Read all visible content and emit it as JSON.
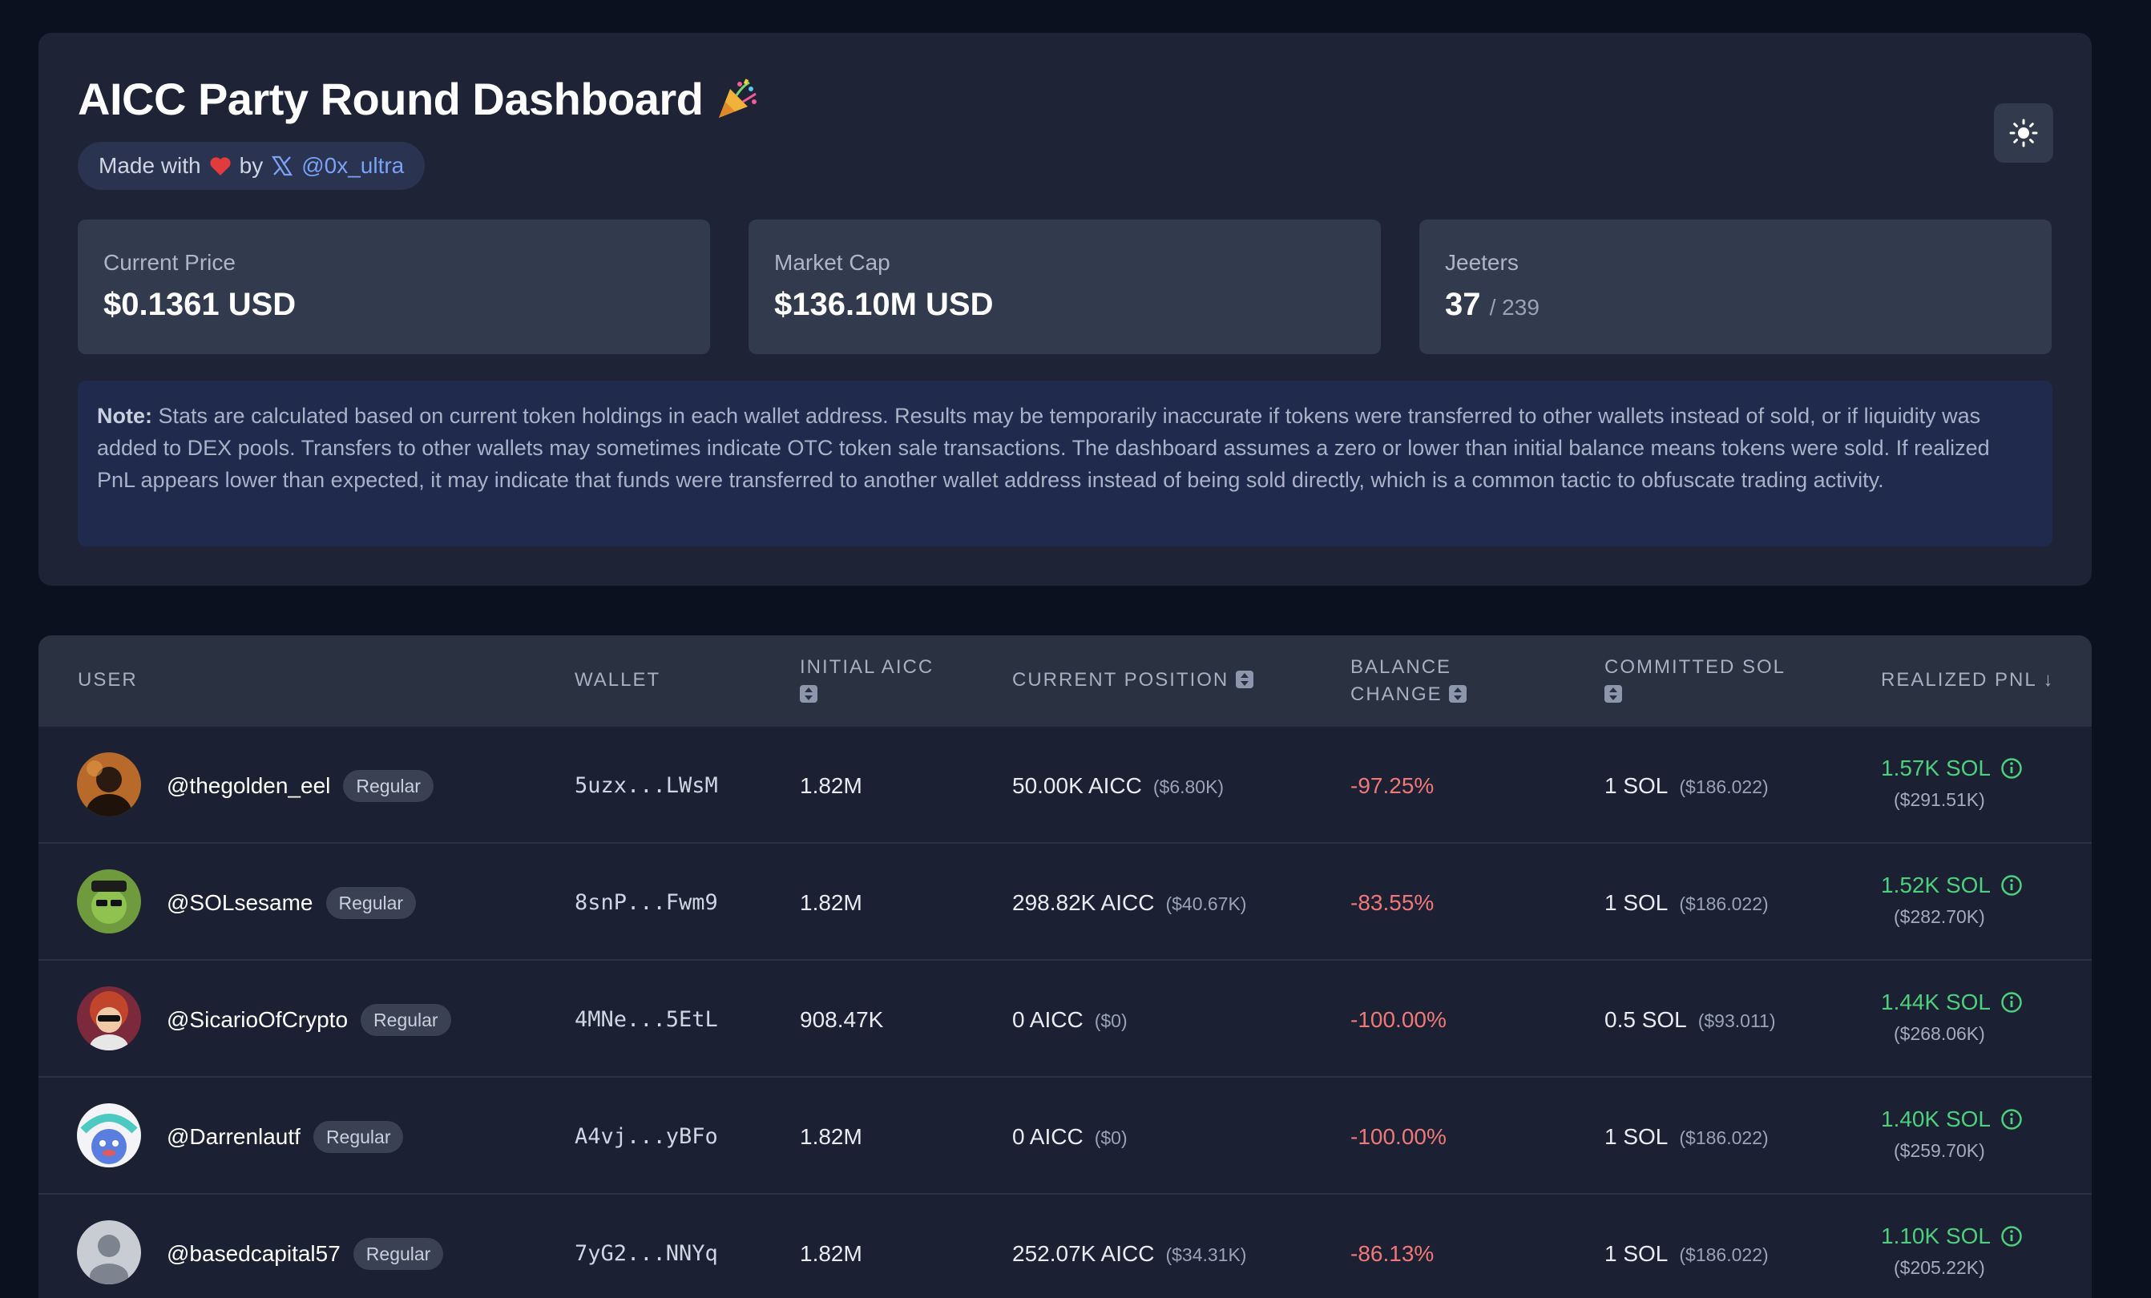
{
  "header": {
    "title": "AICC Party Round Dashboard",
    "credit": {
      "made_with": "Made with",
      "by": "by",
      "handle": "@0x_ultra"
    }
  },
  "stats": [
    {
      "label": "Current Price",
      "value": "$0.1361 USD",
      "sub": ""
    },
    {
      "label": "Market Cap",
      "value": "$136.10M USD",
      "sub": ""
    },
    {
      "label": "Jeeters",
      "value": "37",
      "sub": "/ 239"
    }
  ],
  "note": {
    "label": "Note:",
    "text": "Stats are calculated based on current token holdings in each wallet address. Results may be temporarily inaccurate if tokens were transferred to other wallets instead of sold, or if liquidity was added to DEX pools. Transfers to other wallets may sometimes indicate OTC token sale transactions. The dashboard assumes a zero or lower than initial balance means tokens were sold. If realized PnL appears lower than expected, it may indicate that funds were transferred to another wallet address instead of being sold directly, which is a common tactic to obfuscate trading activity."
  },
  "table": {
    "columns": {
      "user": "USER",
      "wallet": "WALLET",
      "initial_line1": "INITIAL AICC",
      "current_position": "CURRENT POSITION",
      "balance_line1": "BALANCE",
      "balance_line2": "CHANGE",
      "committed_line1": "COMMITTED SOL",
      "realized_pnl": "REALIZED PNL ↓"
    },
    "rows": [
      {
        "user": "@thegolden_eel",
        "badge": "Regular",
        "wallet": "5uzx...LWsM",
        "initial": "1.82M",
        "position": "50.00K AICC",
        "position_usd": "($6.80K)",
        "balance_change": "-97.25%",
        "committed": "1 SOL",
        "committed_usd": "($186.022)",
        "pnl": "1.57K SOL",
        "pnl_usd": "($291.51K)"
      },
      {
        "user": "@SOLsesame",
        "badge": "Regular",
        "wallet": "8snP...Fwm9",
        "initial": "1.82M",
        "position": "298.82K AICC",
        "position_usd": "($40.67K)",
        "balance_change": "-83.55%",
        "committed": "1 SOL",
        "committed_usd": "($186.022)",
        "pnl": "1.52K SOL",
        "pnl_usd": "($282.70K)"
      },
      {
        "user": "@SicarioOfCrypto",
        "badge": "Regular",
        "wallet": "4MNe...5EtL",
        "initial": "908.47K",
        "position": "0 AICC",
        "position_usd": "($0)",
        "balance_change": "-100.00%",
        "committed": "0.5 SOL",
        "committed_usd": "($93.011)",
        "pnl": "1.44K SOL",
        "pnl_usd": "($268.06K)"
      },
      {
        "user": "@Darrenlautf",
        "badge": "Regular",
        "wallet": "A4vj...yBFo",
        "initial": "1.82M",
        "position": "0 AICC",
        "position_usd": "($0)",
        "balance_change": "-100.00%",
        "committed": "1 SOL",
        "committed_usd": "($186.022)",
        "pnl": "1.40K SOL",
        "pnl_usd": "($259.70K)"
      },
      {
        "user": "@basedcapital57",
        "badge": "Regular",
        "wallet": "7yG2...NNYq",
        "initial": "1.82M",
        "position": "252.07K AICC",
        "position_usd": "($34.31K)",
        "balance_change": "-86.13%",
        "committed": "1 SOL",
        "committed_usd": "($186.022)",
        "pnl": "1.10K SOL",
        "pnl_usd": "($205.22K)"
      }
    ]
  },
  "colors": {
    "background": "#0c1120",
    "card": "#1e2435",
    "positive": "#4cd07d",
    "negative": "#f07878",
    "link": "#7aa3f5"
  },
  "icons": {
    "title": "party-popper-icon",
    "credit_heart": "heart-icon",
    "credit_brand": "x-logo-icon",
    "theme_toggle": "sun-icon",
    "sort": "sort-icon",
    "pnl_info": "info-icon"
  }
}
